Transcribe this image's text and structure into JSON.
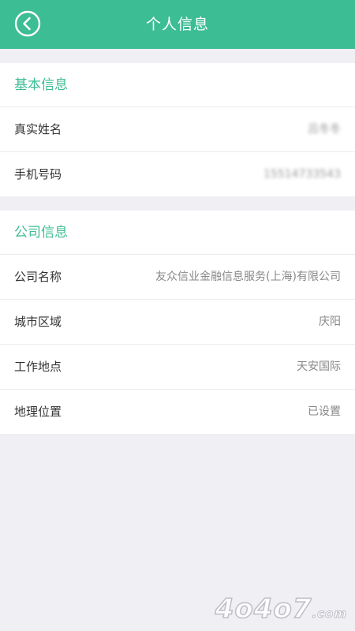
{
  "header": {
    "title": "个人信息",
    "back_icon": "chevron-left-circle",
    "accent": "#3dbd94"
  },
  "basic_info": {
    "title": "基本信息",
    "rows": [
      {
        "label": "真实姓名",
        "value": "吕冬冬"
      },
      {
        "label": "手机号码",
        "value": "15514733543"
      }
    ]
  },
  "company_info": {
    "title": "公司信息",
    "rows": [
      {
        "label": "公司名称",
        "value": "友众信业金融信息服务(上海)有限公司"
      },
      {
        "label": "城市区域",
        "value": "庆阳"
      },
      {
        "label": "工作地点",
        "value": "天安国际"
      },
      {
        "label": "地理位置",
        "value": "已设置"
      }
    ]
  },
  "watermark": {
    "main": "4o4o7",
    "suffix": ".com"
  }
}
